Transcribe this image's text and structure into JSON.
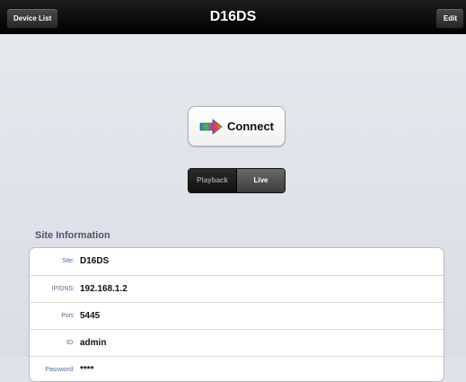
{
  "navbar": {
    "title": "D16DS",
    "left_button": "Device List",
    "right_button": "Edit"
  },
  "connect": {
    "label": "Connect",
    "icon": "arrow-right-icon"
  },
  "mode_segment": {
    "options": [
      "Playback",
      "Live"
    ],
    "selected": "Live"
  },
  "site_info": {
    "title": "Site Information",
    "rows": [
      {
        "label": "Site:",
        "value": "D16DS"
      },
      {
        "label": "IP/DNS:",
        "value": "192.168.1.2"
      },
      {
        "label": "Port:",
        "value": "5445"
      },
      {
        "label": "ID:",
        "value": "admin"
      },
      {
        "label": "Password:",
        "value": "****"
      }
    ]
  },
  "colors": {
    "navbar": "#000000",
    "background": "#dfe2e8",
    "label": "#4f6b99",
    "section_title": "#4c566a"
  }
}
